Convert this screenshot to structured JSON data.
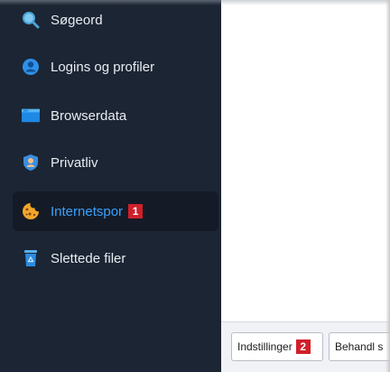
{
  "sidebar": {
    "items": [
      {
        "label": "Søgeord",
        "icon": "search-icon"
      },
      {
        "label": "Logins og profiler",
        "icon": "user-icon"
      },
      {
        "label": "Browserdata",
        "icon": "browser-icon"
      },
      {
        "label": "Privatliv",
        "icon": "shield-icon"
      },
      {
        "label": "Internetspor",
        "icon": "cookie-icon",
        "active": true,
        "badge": "1"
      },
      {
        "label": "Slettede filer",
        "icon": "recycle-bin-icon"
      }
    ]
  },
  "footer": {
    "settings_label": "Indstillinger",
    "settings_badge": "2",
    "behandl_label": "Behandl s"
  },
  "colors": {
    "sidebar_bg": "#1c2533",
    "active_text": "#3aa2ff",
    "badge_red": "#d0202a"
  }
}
